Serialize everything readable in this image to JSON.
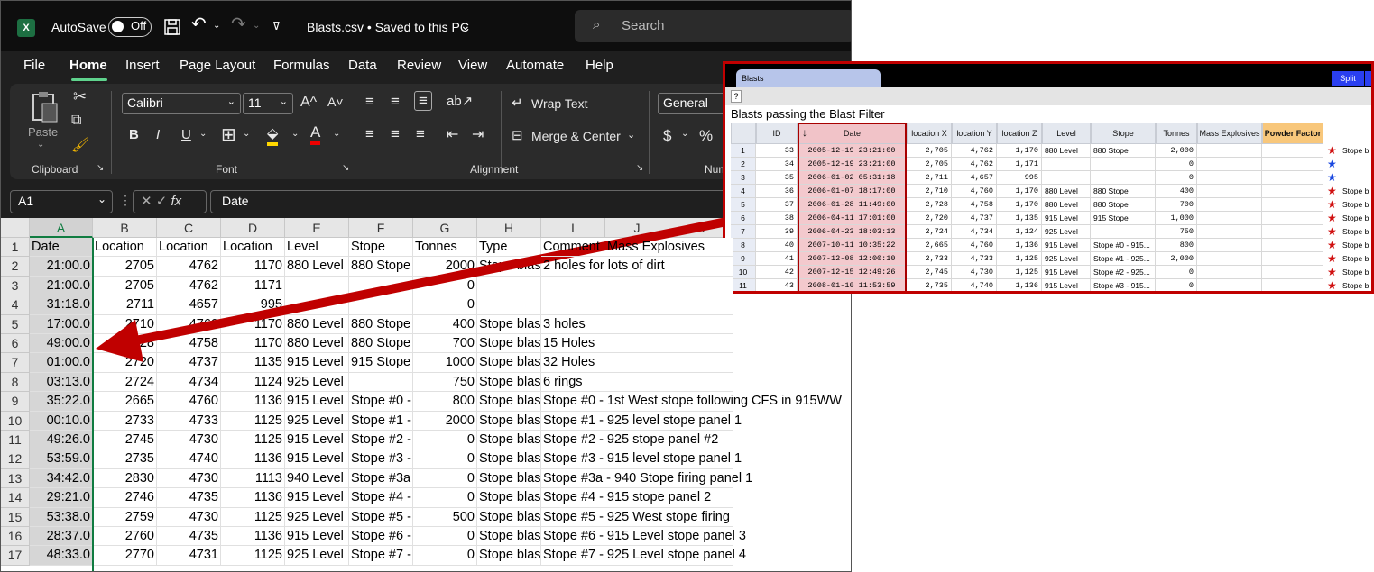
{
  "excel": {
    "logo": "X",
    "autosave_label": "AutoSave",
    "toggle_state": "Off",
    "file_title": "Blasts.csv • Saved to this PC",
    "search_placeholder": "Search",
    "menu": [
      "File",
      "Home",
      "Insert",
      "Page Layout",
      "Formulas",
      "Data",
      "Review",
      "View",
      "Automate",
      "Help"
    ],
    "ribbon": {
      "paste": "Paste",
      "font_name": "Calibri",
      "font_size": "11",
      "grow_font": "A^",
      "shrink_font": "A˅",
      "bold": "B",
      "italic": "I",
      "underline": "U",
      "wrap_text": "Wrap Text",
      "merge_center": "Merge & Center",
      "number_format": "General",
      "currency": "$",
      "percent": "%",
      "groups": [
        "Clipboard",
        "Font",
        "Alignment",
        "Num"
      ]
    },
    "name_box": "A1",
    "formula_value": "Date",
    "columns": [
      "A",
      "B",
      "C",
      "D",
      "E",
      "F",
      "G",
      "H",
      "I",
      "J",
      "K"
    ],
    "rows": [
      {
        "n": "1",
        "cells": [
          "Date",
          "Location",
          "Location",
          "Location",
          "Level",
          "Stope",
          "Tonnes",
          "Type",
          "Comment",
          "Mass Explosives",
          ""
        ]
      },
      {
        "n": "2",
        "cells": [
          "21:00.0",
          "2705",
          "4762",
          "1170",
          "880 Level",
          "880 Stope",
          "2000",
          "Stope blas",
          "2 holes for lots of dirt",
          "",
          ""
        ]
      },
      {
        "n": "3",
        "cells": [
          "21:00.0",
          "2705",
          "4762",
          "1171",
          "",
          "",
          "0",
          "",
          "",
          "",
          ""
        ]
      },
      {
        "n": "4",
        "cells": [
          "31:18.0",
          "2711",
          "4657",
          "995",
          "",
          "",
          "0",
          "",
          "",
          "",
          ""
        ]
      },
      {
        "n": "5",
        "cells": [
          "17:00.0",
          "2710",
          "4760",
          "1170",
          "880 Level",
          "880 Stope",
          "400",
          "Stope blas",
          "3 holes",
          "",
          ""
        ]
      },
      {
        "n": "6",
        "cells": [
          "49:00.0",
          "2728",
          "4758",
          "1170",
          "880 Level",
          "880 Stope",
          "700",
          "Stope blas",
          "15 Holes",
          "",
          ""
        ]
      },
      {
        "n": "7",
        "cells": [
          "01:00.0",
          "2720",
          "4737",
          "1135",
          "915 Level",
          "915 Stope",
          "1000",
          "Stope blas",
          "32 Holes",
          "",
          ""
        ]
      },
      {
        "n": "8",
        "cells": [
          "03:13.0",
          "2724",
          "4734",
          "1124",
          "925 Level",
          "",
          "750",
          "Stope blas",
          "6 rings",
          "",
          ""
        ]
      },
      {
        "n": "9",
        "cells": [
          "35:22.0",
          "2665",
          "4760",
          "1136",
          "915 Level",
          "Stope #0 -",
          "800",
          "Stope blas",
          "Stope #0 - 1st West stope following CFS in 915WW",
          "",
          ""
        ]
      },
      {
        "n": "10",
        "cells": [
          "00:10.0",
          "2733",
          "4733",
          "1125",
          "925 Level",
          "Stope #1 -",
          "2000",
          "Stope blas",
          "Stope #1 - 925 level stope panel 1",
          "",
          ""
        ]
      },
      {
        "n": "11",
        "cells": [
          "49:26.0",
          "2745",
          "4730",
          "1125",
          "915 Level",
          "Stope #2 -",
          "0",
          "Stope blas",
          "Stope #2 - 925 stope panel #2",
          "",
          ""
        ]
      },
      {
        "n": "12",
        "cells": [
          "53:59.0",
          "2735",
          "4740",
          "1136",
          "915 Level",
          "Stope #3 -",
          "0",
          "Stope blas",
          "Stope #3 - 915 level stope panel 1",
          "",
          ""
        ]
      },
      {
        "n": "13",
        "cells": [
          "34:42.0",
          "2830",
          "4730",
          "1113",
          "940 Level",
          "Stope #3a",
          "0",
          "Stope blas",
          "Stope #3a - 940 Stope firing panel 1",
          "",
          ""
        ]
      },
      {
        "n": "14",
        "cells": [
          "29:21.0",
          "2746",
          "4735",
          "1136",
          "915 Level",
          "Stope #4 -",
          "0",
          "Stope blas",
          "Stope #4 - 915 stope panel 2",
          "",
          ""
        ]
      },
      {
        "n": "15",
        "cells": [
          "53:38.0",
          "2759",
          "4730",
          "1125",
          "925 Level",
          "Stope #5 -",
          "500",
          "Stope blas",
          "Stope #5 - 925 West stope firing",
          "",
          ""
        ]
      },
      {
        "n": "16",
        "cells": [
          "28:37.0",
          "2760",
          "4735",
          "1136",
          "915 Level",
          "Stope #6 -",
          "0",
          "Stope blas",
          "Stope #6 - 915 Level stope panel 3",
          "",
          ""
        ]
      },
      {
        "n": "17",
        "cells": [
          "48:33.0",
          "2770",
          "4731",
          "1125",
          "925 Level",
          "Stope #7 -",
          "0",
          "Stope blas",
          "Stope #7 - 925 Level stope panel 4",
          "",
          ""
        ]
      }
    ]
  },
  "app": {
    "tab": "Blasts",
    "split_button": "Split",
    "help_button": "?",
    "heading": "Blasts passing the Blast Filter",
    "sort_arrow": "↓",
    "headers": [
      "",
      "ID",
      "Date",
      "location X",
      "location Y",
      "location Z",
      "Level",
      "Stope",
      "Tonnes",
      "Mass Explosives",
      "Powder Factor"
    ],
    "rows": [
      {
        "i": "1",
        "id": "33",
        "date": "2005-12-19 23:21:00",
        "x": "2,705",
        "y": "4,762",
        "z": "1,170",
        "level": "880 Level",
        "stope": "880 Stope",
        "tonnes": "2,000",
        "star": "red"
      },
      {
        "i": "2",
        "id": "34",
        "date": "2005-12-19 23:21:00",
        "x": "2,705",
        "y": "4,762",
        "z": "1,171",
        "level": "",
        "stope": "",
        "tonnes": "0",
        "star": "blue"
      },
      {
        "i": "3",
        "id": "35",
        "date": "2006-01-02 05:31:18",
        "x": "2,711",
        "y": "4,657",
        "z": "995",
        "level": "",
        "stope": "",
        "tonnes": "0",
        "star": "blue"
      },
      {
        "i": "4",
        "id": "36",
        "date": "2006-01-07 18:17:00",
        "x": "2,710",
        "y": "4,760",
        "z": "1,170",
        "level": "880 Level",
        "stope": "880 Stope",
        "tonnes": "400",
        "star": "red"
      },
      {
        "i": "5",
        "id": "37",
        "date": "2006-01-28 11:49:00",
        "x": "2,728",
        "y": "4,758",
        "z": "1,170",
        "level": "880 Level",
        "stope": "880 Stope",
        "tonnes": "700",
        "star": "red"
      },
      {
        "i": "6",
        "id": "38",
        "date": "2006-04-11 17:01:00",
        "x": "2,720",
        "y": "4,737",
        "z": "1,135",
        "level": "915 Level",
        "stope": "915 Stope",
        "tonnes": "1,000",
        "star": "red"
      },
      {
        "i": "7",
        "id": "39",
        "date": "2006-04-23 18:03:13",
        "x": "2,724",
        "y": "4,734",
        "z": "1,124",
        "level": "925 Level",
        "stope": "",
        "tonnes": "750",
        "star": "red"
      },
      {
        "i": "8",
        "id": "40",
        "date": "2007-10-11 10:35:22",
        "x": "2,665",
        "y": "4,760",
        "z": "1,136",
        "level": "915 Level",
        "stope": "Stope #0 - 915...",
        "tonnes": "800",
        "star": "red"
      },
      {
        "i": "9",
        "id": "41",
        "date": "2007-12-08 12:00:10",
        "x": "2,733",
        "y": "4,733",
        "z": "1,125",
        "level": "925 Level",
        "stope": "Stope #1 - 925...",
        "tonnes": "2,000",
        "star": "red"
      },
      {
        "i": "10",
        "id": "42",
        "date": "2007-12-15 12:49:26",
        "x": "2,745",
        "y": "4,730",
        "z": "1,125",
        "level": "915 Level",
        "stope": "Stope #2 - 925...",
        "tonnes": "0",
        "star": "red"
      },
      {
        "i": "11",
        "id": "43",
        "date": "2008-01-10 11:53:59",
        "x": "2,735",
        "y": "4,740",
        "z": "1,136",
        "level": "915 Level",
        "stope": "Stope #3 - 915...",
        "tonnes": "0",
        "star": "red"
      }
    ],
    "star_label": "Stope b",
    "star_colors": {
      "red": "#d01010",
      "blue": "#1a48e0"
    }
  },
  "arrow_color": "#c00000"
}
